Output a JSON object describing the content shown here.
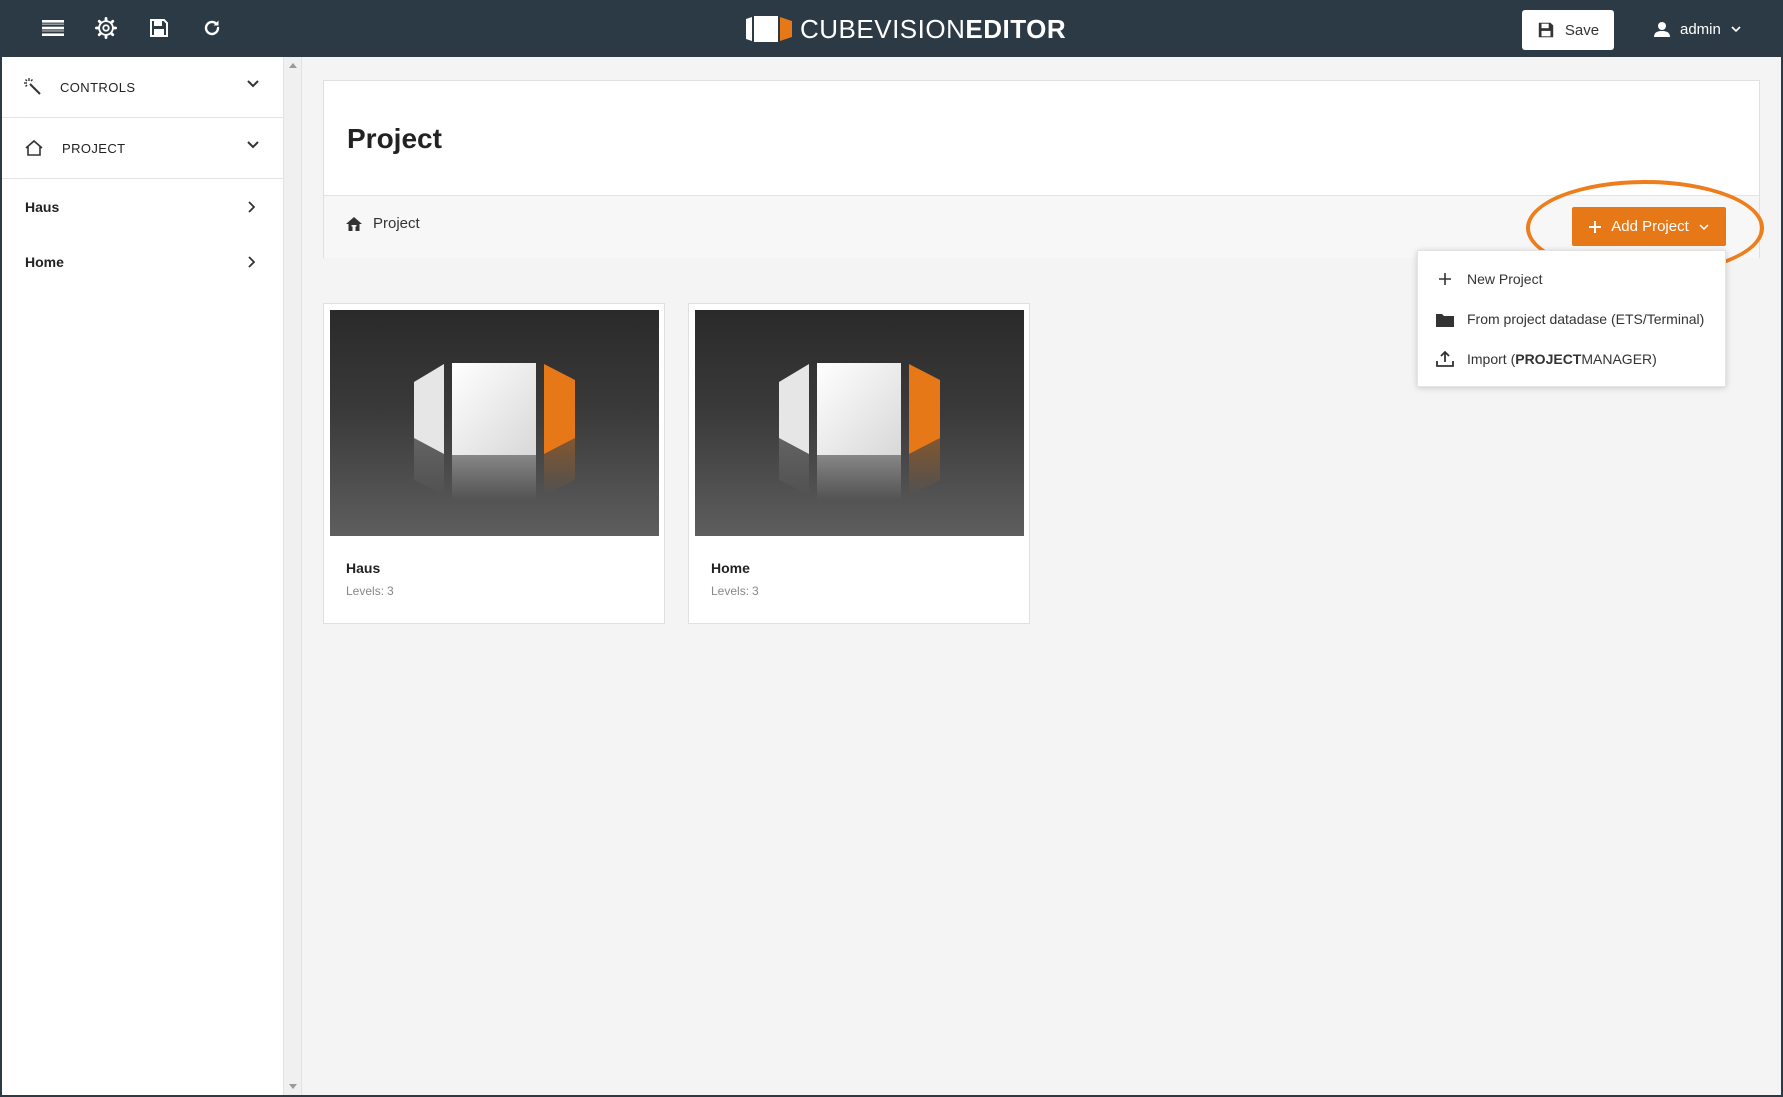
{
  "brand": {
    "light": "CUBEVISION",
    "bold": "EDITOR"
  },
  "toolbar": {
    "save_label": "Save",
    "user_name": "admin"
  },
  "sidebar": {
    "sections": [
      {
        "label": "CONTROLS",
        "icon": "magic-wand-icon"
      },
      {
        "label": "PROJECT",
        "icon": "home-outline-icon"
      }
    ],
    "items": [
      {
        "label": "Haus"
      },
      {
        "label": "Home"
      }
    ]
  },
  "page": {
    "title": "Project",
    "breadcrumb": "Project"
  },
  "add_project": {
    "label": "Add Project",
    "menu": [
      {
        "label": "New Project",
        "icon": "plus-icon"
      },
      {
        "label": "From project datadase (ETS/Terminal)",
        "icon": "folder-icon"
      },
      {
        "prefix": "Import (",
        "bold": "PROJECT",
        "suffix": "MANAGER)",
        "icon": "upload-icon"
      }
    ]
  },
  "projects": [
    {
      "name": "Haus",
      "levels_label": "Levels:",
      "levels": "3"
    },
    {
      "name": "Home",
      "levels_label": "Levels:",
      "levels": "3"
    }
  ],
  "colors": {
    "topbar": "#2c3a45",
    "accent": "#e67817",
    "background": "#f4f4f4"
  }
}
